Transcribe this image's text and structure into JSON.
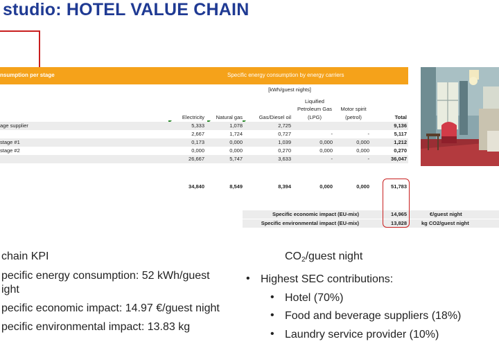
{
  "title": "studio: HOTEL VALUE CHAIN",
  "table": {
    "header_left": "nsumption per stage",
    "header_center": "Specific energy consumption by energy carriers",
    "unit": "[kWh/guest nights]",
    "columns": [
      "Electricity",
      "Natural gas",
      "Gas/Diesel oil",
      "Liquified Petroleum Gas (LPG)",
      "Motor spirit (petrol)",
      "Total"
    ],
    "col_lpg_line1": "Liquified",
    "col_lpg_line2": "Petroleum Gas",
    "col_lpg_line3": "(LPG)",
    "col_petrol_line1": "Motor spirit",
    "col_petrol_line2": "(petrol)",
    "rows": [
      {
        "label": "age supplier",
        "values": [
          "5,333",
          "1,078",
          "2,725",
          "",
          "",
          "9,136"
        ]
      },
      {
        "label": "",
        "values": [
          "2,667",
          "1,724",
          "0,727",
          "-",
          "-",
          "5,117"
        ]
      },
      {
        "label": "stage #1",
        "values": [
          "0,173",
          "0,000",
          "1,039",
          "0,000",
          "0,000",
          "1,212"
        ]
      },
      {
        "label": "stage #2",
        "values": [
          "0,000",
          "0,000",
          "0,270",
          "0,000",
          "0,000",
          "0,270"
        ]
      },
      {
        "label": "",
        "values": [
          "26,667",
          "5,747",
          "3,633",
          "-",
          "-",
          "36,047"
        ]
      }
    ],
    "totals": [
      "34,840",
      "8,549",
      "8,394",
      "0,000",
      "0,000",
      "51,783"
    ],
    "impacts": [
      {
        "label": "Specific economic impact (EU-mix)",
        "value": "14,965",
        "unit": "€/guest night"
      },
      {
        "label": "Specific environmental impact (EU-mix)",
        "value": "13,828",
        "unit": "kg CO2/guest night"
      }
    ]
  },
  "kpi": {
    "heading": "chain KPI",
    "line1a": "pecific energy consumption: 52 kWh/guest",
    "line1b": "ight",
    "line2": "pecific economic impact: 14.97 €/guest night",
    "line3": "pecific environmental impact: 13.83 kg"
  },
  "right_list": {
    "co2_prefix": "CO",
    "co2_sub": "2",
    "co2_suffix": "/guest night",
    "heading": "Highest SEC contributions:",
    "items": [
      "Hotel (70%)",
      "Food and beverage suppliers (18%)",
      "Laundry service provider (10%)"
    ]
  },
  "colors": {
    "title": "#1f3a93",
    "band": "#f5a21a",
    "highlight": "#c81e1e",
    "marker": "#2e8b2e"
  }
}
